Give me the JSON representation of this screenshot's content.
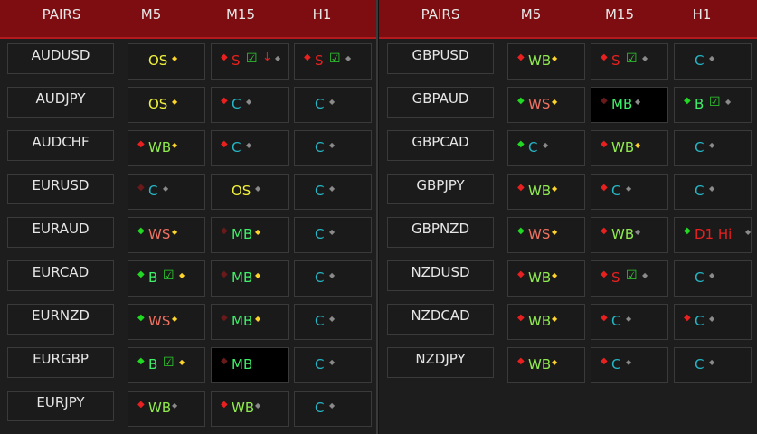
{
  "colors": {
    "header_bg": "#7d0d10",
    "red": "#e82020",
    "green": "#22d822",
    "dark_red": "#6a1a1a",
    "yellow": "#f2f23a",
    "cyan": "#26b7c7",
    "salmon": "#ee7060",
    "light_green": "#8fea4f",
    "bright_green": "#3ff06a",
    "gray": "#8a8a8a",
    "gold": "#ffd42a"
  },
  "left": {
    "headers": [
      "PAIRS",
      "M5",
      "M15",
      "H1"
    ],
    "rows": [
      {
        "pair": "AUDUSD",
        "m5": {
          "dot": "none",
          "text": "OS",
          "tc": "yellow",
          "check": false,
          "small": "gold"
        },
        "m15": {
          "dot": "red",
          "text": "S",
          "tc": "red",
          "check": true,
          "arrow": true,
          "small": "gray"
        },
        "h1": {
          "dot": "red",
          "text": "S",
          "tc": "red",
          "check": true,
          "small": "gray"
        }
      },
      {
        "pair": "AUDJPY",
        "m5": {
          "dot": "none",
          "text": "OS",
          "tc": "yellow",
          "check": false,
          "small": "gold"
        },
        "m15": {
          "dot": "red",
          "text": "C",
          "tc": "cyan",
          "check": false,
          "small": "gray"
        },
        "h1": {
          "dot": "none",
          "text": "C",
          "tc": "cyan",
          "check": false,
          "small": "gray"
        }
      },
      {
        "pair": "AUDCHF",
        "m5": {
          "dot": "red",
          "text": "WB",
          "tc": "light_green",
          "check": false,
          "small": "gold"
        },
        "m15": {
          "dot": "red",
          "text": "C",
          "tc": "cyan",
          "check": false,
          "small": "gray"
        },
        "h1": {
          "dot": "none",
          "text": "C",
          "tc": "cyan",
          "check": false,
          "small": "gray"
        }
      },
      {
        "pair": "EURUSD",
        "m5": {
          "dot": "dark_red",
          "text": "C",
          "tc": "cyan",
          "check": false,
          "small": "gray"
        },
        "m15": {
          "dot": "none",
          "text": "OS",
          "tc": "yellow",
          "check": false,
          "small": "gray"
        },
        "h1": {
          "dot": "none",
          "text": "C",
          "tc": "cyan",
          "check": false,
          "small": "gray"
        }
      },
      {
        "pair": "EURAUD",
        "m5": {
          "dot": "green",
          "text": "WS",
          "tc": "salmon",
          "check": false,
          "small": "gold"
        },
        "m15": {
          "dot": "dark_red",
          "text": "MB",
          "tc": "bright_green",
          "check": false,
          "small": "gold"
        },
        "h1": {
          "dot": "none",
          "text": "C",
          "tc": "cyan",
          "check": false,
          "small": "gray"
        }
      },
      {
        "pair": "EURCAD",
        "m5": {
          "dot": "green",
          "text": "B",
          "tc": "bright_green",
          "check": true,
          "small": "gold"
        },
        "m15": {
          "dot": "dark_red",
          "text": "MB",
          "tc": "bright_green",
          "check": false,
          "small": "gold"
        },
        "h1": {
          "dot": "none",
          "text": "C",
          "tc": "cyan",
          "check": false,
          "small": "gray"
        }
      },
      {
        "pair": "EURNZD",
        "m5": {
          "dot": "green",
          "text": "WS",
          "tc": "salmon",
          "check": false,
          "small": "gold"
        },
        "m15": {
          "dot": "dark_red",
          "text": "MB",
          "tc": "bright_green",
          "check": false,
          "small": "gold"
        },
        "h1": {
          "dot": "none",
          "text": "C",
          "tc": "cyan",
          "check": false,
          "small": "gray"
        }
      },
      {
        "pair": "EURGBP",
        "m5": {
          "dot": "green",
          "text": "B",
          "tc": "bright_green",
          "check": true,
          "small": "gold"
        },
        "m15": {
          "dot": "dark_red",
          "text": "MB",
          "tc": "bright_green",
          "check": false,
          "small": "none",
          "dark": true
        },
        "h1": {
          "dot": "none",
          "text": "C",
          "tc": "cyan",
          "check": false,
          "small": "gray"
        }
      },
      {
        "pair": "EURJPY",
        "m5": {
          "dot": "red",
          "text": "WB",
          "tc": "light_green",
          "check": false,
          "small": "gray"
        },
        "m15": {
          "dot": "red",
          "text": "WB",
          "tc": "light_green",
          "check": false,
          "small": "gray"
        },
        "h1": {
          "dot": "none",
          "text": "C",
          "tc": "cyan",
          "check": false,
          "small": "gray"
        }
      }
    ]
  },
  "right": {
    "headers": [
      "PAIRS",
      "M5",
      "M15",
      "H1"
    ],
    "rows": [
      {
        "pair": "GBPUSD",
        "m5": {
          "dot": "red",
          "text": "WB",
          "tc": "light_green",
          "check": false,
          "small": "gold"
        },
        "m15": {
          "dot": "red",
          "text": "S",
          "tc": "red",
          "check": true,
          "small": "gray"
        },
        "h1": {
          "dot": "none",
          "text": "C",
          "tc": "cyan",
          "check": false,
          "small": "gray"
        }
      },
      {
        "pair": "GBPAUD",
        "m5": {
          "dot": "green",
          "text": "WS",
          "tc": "salmon",
          "check": false,
          "small": "gold"
        },
        "m15": {
          "dot": "dark_red",
          "text": "MB",
          "tc": "bright_green",
          "check": false,
          "small": "gray",
          "dark": true
        },
        "h1": {
          "dot": "green",
          "text": "B",
          "tc": "bright_green",
          "check": true,
          "small": "gray"
        }
      },
      {
        "pair": "GBPCAD",
        "m5": {
          "dot": "green",
          "text": "C",
          "tc": "cyan",
          "check": false,
          "small": "gray"
        },
        "m15": {
          "dot": "red",
          "text": "WB",
          "tc": "light_green",
          "check": false,
          "small": "gold"
        },
        "h1": {
          "dot": "none",
          "text": "C",
          "tc": "cyan",
          "check": false,
          "small": "gray"
        }
      },
      {
        "pair": "GBPJPY",
        "m5": {
          "dot": "red",
          "text": "WB",
          "tc": "light_green",
          "check": false,
          "small": "gold"
        },
        "m15": {
          "dot": "red",
          "text": "C",
          "tc": "cyan",
          "check": false,
          "small": "gray"
        },
        "h1": {
          "dot": "none",
          "text": "C",
          "tc": "cyan",
          "check": false,
          "small": "gray"
        }
      },
      {
        "pair": "GBPNZD",
        "m5": {
          "dot": "green",
          "text": "WS",
          "tc": "salmon",
          "check": false,
          "small": "gold"
        },
        "m15": {
          "dot": "red",
          "text": "WB",
          "tc": "light_green",
          "check": false,
          "small": "gray"
        },
        "h1": {
          "dot": "green",
          "text": "D1 Hi",
          "tc": "red",
          "check": false,
          "small": "gray"
        }
      },
      {
        "pair": "NZDUSD",
        "m5": {
          "dot": "red",
          "text": "WB",
          "tc": "light_green",
          "check": false,
          "small": "gold"
        },
        "m15": {
          "dot": "red",
          "text": "S",
          "tc": "red",
          "check": true,
          "small": "gray"
        },
        "h1": {
          "dot": "none",
          "text": "C",
          "tc": "cyan",
          "check": false,
          "small": "gray"
        }
      },
      {
        "pair": "NZDCAD",
        "m5": {
          "dot": "red",
          "text": "WB",
          "tc": "light_green",
          "check": false,
          "small": "gold"
        },
        "m15": {
          "dot": "red",
          "text": "C",
          "tc": "cyan",
          "check": false,
          "small": "gray"
        },
        "h1": {
          "dot": "red",
          "text": "C",
          "tc": "cyan",
          "check": false,
          "small": "gray"
        }
      },
      {
        "pair": "NZDJPY",
        "m5": {
          "dot": "red",
          "text": "WB",
          "tc": "light_green",
          "check": false,
          "small": "gold"
        },
        "m15": {
          "dot": "red",
          "text": "C",
          "tc": "cyan",
          "check": false,
          "small": "gray"
        },
        "h1": {
          "dot": "none",
          "text": "C",
          "tc": "cyan",
          "check": false,
          "small": "gray"
        }
      }
    ]
  }
}
